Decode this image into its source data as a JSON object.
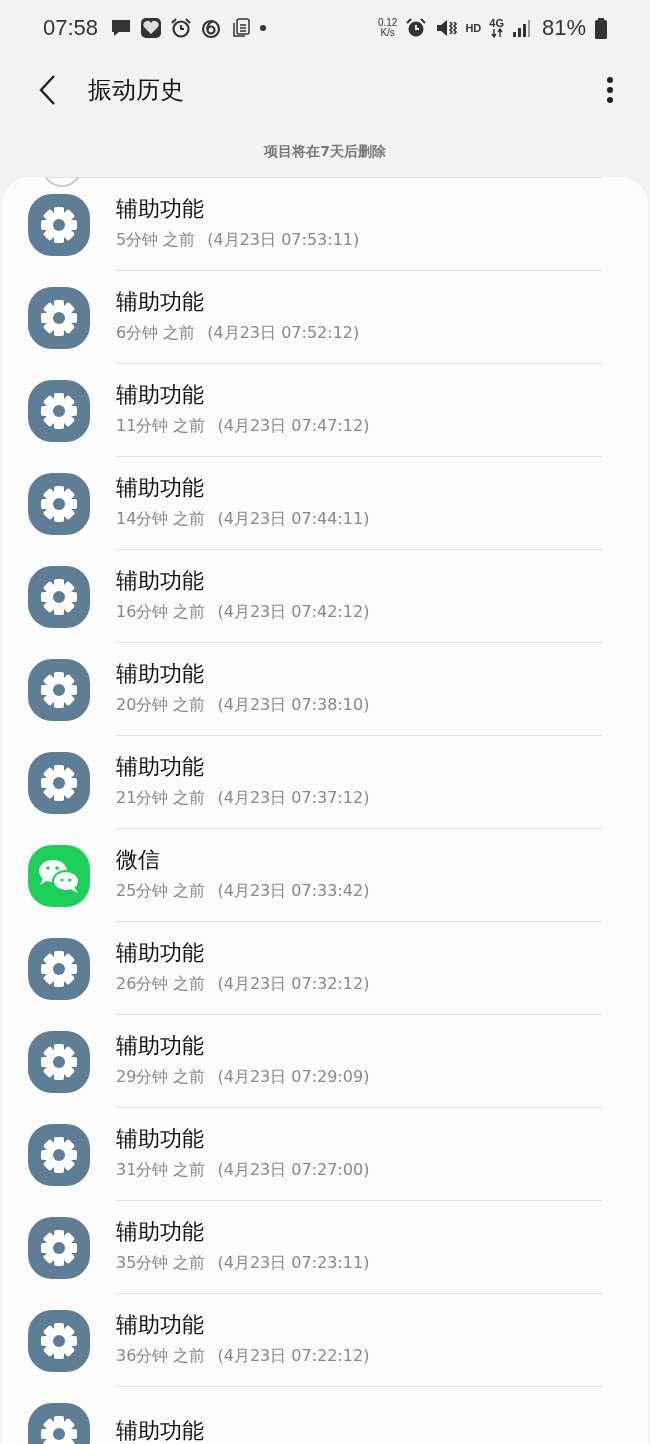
{
  "status_bar": {
    "time": "07:58",
    "net_speed_value": "0.12",
    "net_speed_unit": "K/s",
    "network": "4G",
    "hd": "HD",
    "battery": "81%"
  },
  "header": {
    "title": "振动历史"
  },
  "note": "项目将在7天后删除",
  "items": [
    {
      "kind": "settings",
      "app": "辅助功能",
      "ago": "5分钟 之前",
      "datetime": "(4月23日 07:53:11)"
    },
    {
      "kind": "settings",
      "app": "辅助功能",
      "ago": "6分钟 之前",
      "datetime": "(4月23日 07:52:12)"
    },
    {
      "kind": "settings",
      "app": "辅助功能",
      "ago": "11分钟 之前",
      "datetime": "(4月23日 07:47:12)"
    },
    {
      "kind": "settings",
      "app": "辅助功能",
      "ago": "14分钟 之前",
      "datetime": "(4月23日 07:44:11)"
    },
    {
      "kind": "settings",
      "app": "辅助功能",
      "ago": "16分钟 之前",
      "datetime": "(4月23日 07:42:12)"
    },
    {
      "kind": "settings",
      "app": "辅助功能",
      "ago": "20分钟 之前",
      "datetime": "(4月23日 07:38:10)"
    },
    {
      "kind": "settings",
      "app": "辅助功能",
      "ago": "21分钟 之前",
      "datetime": "(4月23日 07:37:12)"
    },
    {
      "kind": "chat",
      "app": "微信",
      "ago": "25分钟 之前",
      "datetime": "(4月23日 07:33:42)"
    },
    {
      "kind": "settings",
      "app": "辅助功能",
      "ago": "26分钟 之前",
      "datetime": "(4月23日 07:32:12)"
    },
    {
      "kind": "settings",
      "app": "辅助功能",
      "ago": "29分钟 之前",
      "datetime": "(4月23日 07:29:09)"
    },
    {
      "kind": "settings",
      "app": "辅助功能",
      "ago": "31分钟 之前",
      "datetime": "(4月23日 07:27:00)"
    },
    {
      "kind": "settings",
      "app": "辅助功能",
      "ago": "35分钟 之前",
      "datetime": "(4月23日 07:23:11)"
    },
    {
      "kind": "settings",
      "app": "辅助功能",
      "ago": "36分钟 之前",
      "datetime": "(4月23日 07:22:12)"
    },
    {
      "kind": "settings",
      "app": "辅助功能"
    }
  ]
}
